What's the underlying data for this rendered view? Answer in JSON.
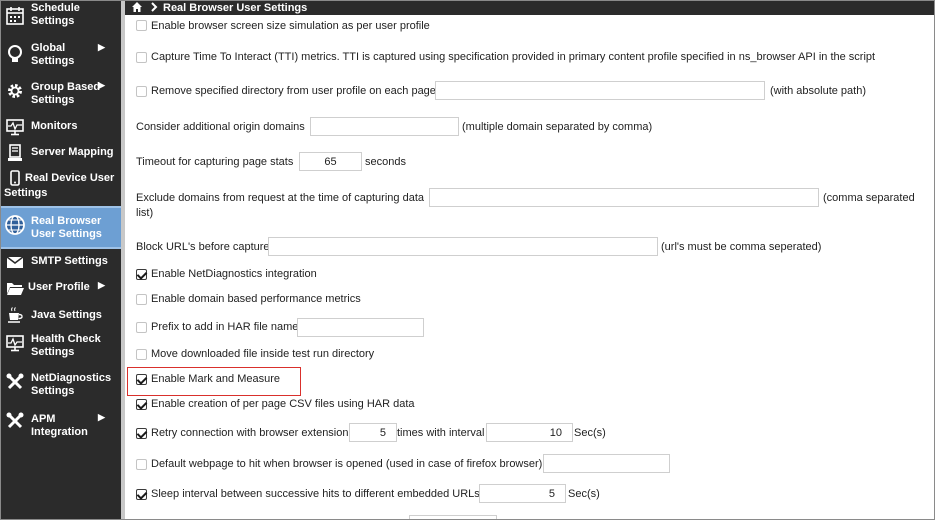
{
  "breadcrumb": {
    "title": "Real Browser User Settings"
  },
  "sidebar": {
    "items": [
      {
        "line1": "Schedule",
        "line2": "Settings"
      },
      {
        "line1": "Global",
        "line2": "Settings"
      },
      {
        "line1": "Group Based",
        "line2": "Settings"
      },
      {
        "line1": "Monitors"
      },
      {
        "line1": "Server Mapping"
      },
      {
        "line1": "Real Device User",
        "line2": "Settings"
      },
      {
        "line1": "Real Browser",
        "line2": "User Settings",
        "active": true
      },
      {
        "line1": "SMTP Settings"
      },
      {
        "line1": "User Profile"
      },
      {
        "line1": "Java Settings"
      },
      {
        "line1": "Health Check",
        "line2": "Settings"
      },
      {
        "line1": "NetDiagnostics",
        "line2": "Settings"
      },
      {
        "line1": "APM",
        "line2": "Integration"
      }
    ]
  },
  "settings": {
    "screen_sim": {
      "label": "Enable browser screen size simulation as per user profile",
      "checked": false
    },
    "tti": {
      "label": "Capture Time To Interact (TTI) metrics. TTI is captured using specification provided in primary content profile specified in ns_browser API in the script",
      "checked": false
    },
    "remove_dir": {
      "label": "Remove specified directory from user profile on each page",
      "value": "",
      "hint": "(with absolute path)",
      "checked": false
    },
    "origin_domains": {
      "label": "Consider additional origin domains",
      "value": "",
      "hint": "(multiple domain separated by comma)"
    },
    "timeout": {
      "label": "Timeout for capturing page stats",
      "value": "65",
      "unit": "seconds"
    },
    "exclude_domains": {
      "label": "Exclude domains from request at the time of capturing data",
      "value": "",
      "hint_line1": "(comma separated",
      "hint_line2": "list)"
    },
    "block_urls": {
      "label": "Block URL's before capture",
      "value": "",
      "hint": "(url's must be comma seperated)"
    },
    "netdiag": {
      "label": "Enable NetDiagnostics integration",
      "checked": true
    },
    "domain_perf": {
      "label": "Enable domain based performance metrics",
      "checked": false
    },
    "har_prefix": {
      "label": "Prefix to add in HAR file name",
      "value": "",
      "checked": false
    },
    "move_download": {
      "label": "Move downloaded file inside test run directory",
      "checked": false
    },
    "mark_measure": {
      "label": "Enable Mark and Measure",
      "checked": true
    },
    "csv_files": {
      "label": "Enable creation of per page CSV files using HAR data",
      "checked": true
    },
    "retry": {
      "label": "Retry connection with browser extension",
      "times_value": "5",
      "times_label": "times with interval",
      "interval_value": "10",
      "unit": "Sec(s)",
      "checked": true
    },
    "default_page": {
      "label": "Default webpage to hit when browser is opened (used in case of firefox browser)",
      "value": "",
      "checked": false
    },
    "sleep_interval": {
      "label": "Sleep interval between successive hits to different embedded URLs",
      "value": "5",
      "unit": "Sec(s)",
      "checked": true
    }
  }
}
